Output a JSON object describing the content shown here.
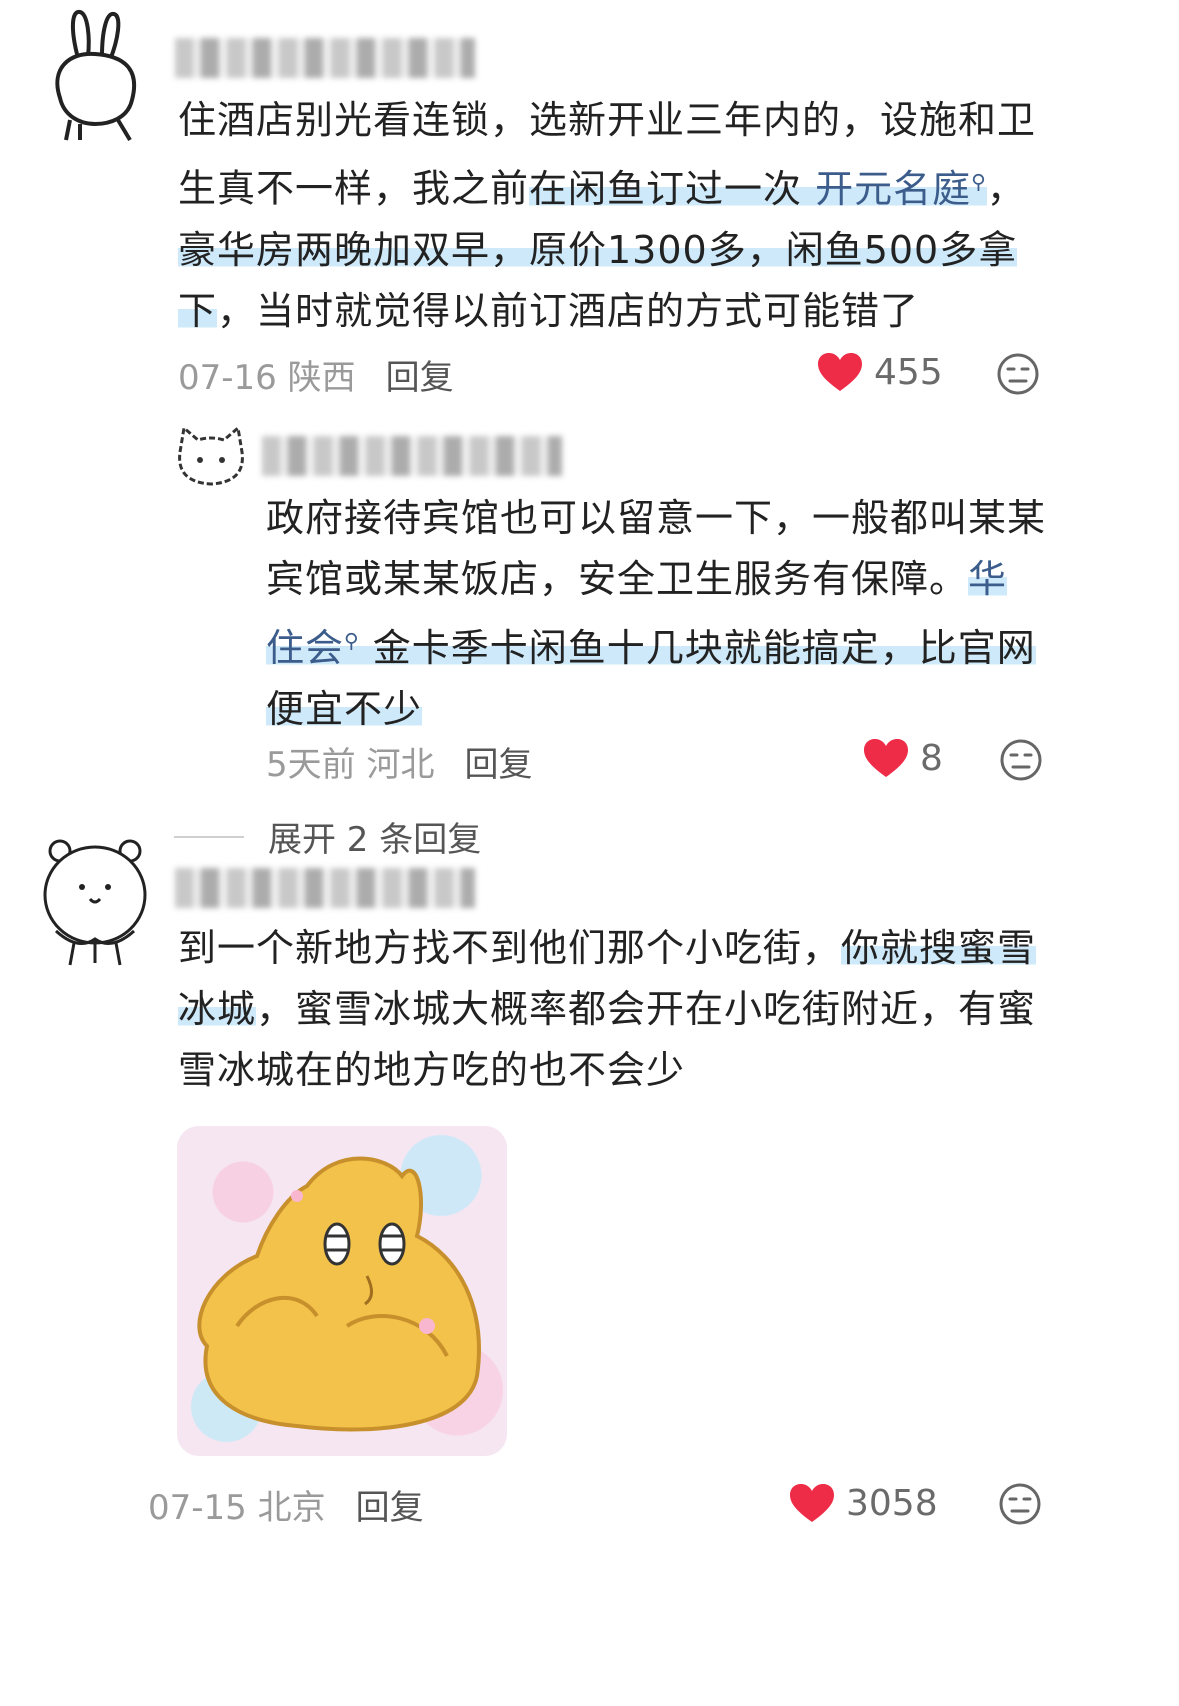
{
  "comments": [
    {
      "username": "",
      "text_parts": [
        {
          "t": "住酒店别光看连锁，选新开业三年内的，设施和卫生真不一样，我之前",
          "hl": false
        },
        {
          "t": "在闲鱼订过一次 ",
          "hl": true
        },
        {
          "t": "开元名庭",
          "hl": true,
          "topic": true
        },
        {
          "t": "，",
          "hl": false
        },
        {
          "t": "豪华房两晚加双早，原价1300多，闲鱼500多拿下",
          "hl": true
        },
        {
          "t": "，当时就觉得以前订酒店的方式可能错了",
          "hl": false
        }
      ],
      "date": "07-16",
      "location": "陕西",
      "reply_label": "回复",
      "likes": "455"
    },
    {
      "username": "",
      "text_parts": [
        {
          "t": "政府接待宾馆也可以留意一下，一般都叫某某宾馆或某某饭店，安全卫生服务有保障。",
          "hl": false
        },
        {
          "t": "华住会",
          "hl": true,
          "topic": true
        },
        {
          "t": " 金卡季卡闲鱼十几块就能搞定，比官网便宜不少",
          "hl": true
        }
      ],
      "date": "5天前",
      "location": "河北",
      "reply_label": "回复",
      "likes": "8"
    },
    {
      "username": "",
      "text_parts": [
        {
          "t": "到一个新地方找不到他们那个小吃街，",
          "hl": false
        },
        {
          "t": "你就搜蜜雪冰城",
          "hl": true
        },
        {
          "t": "，蜜雪冰城大概率都会开在小吃街附近，有蜜雪冰城在的地方吃的也不会少",
          "hl": false
        }
      ],
      "date": "07-15",
      "location": "北京",
      "reply_label": "回复",
      "likes": "3058"
    }
  ],
  "expand_replies": "展开 2 条回复",
  "colors": {
    "heart": "#ee2c47",
    "highlight": "#a5d7f5",
    "topic": "#3c5d8c"
  }
}
